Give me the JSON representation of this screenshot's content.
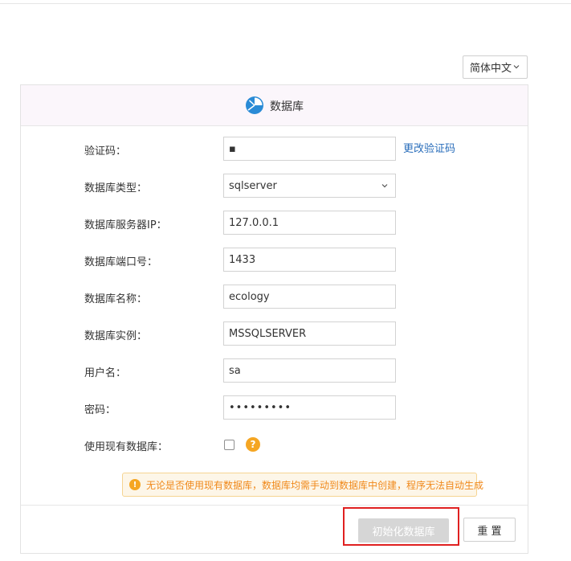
{
  "language": {
    "selected": "简体中文"
  },
  "panel": {
    "title": "数据库",
    "logo_icon": "pie-chart-logo-icon",
    "brand_color": "#2a8bd6"
  },
  "form": {
    "captcha": {
      "label": "验证码：",
      "value": "▪",
      "refresh_link": "更改验证码"
    },
    "db_type": {
      "label": "数据库类型：",
      "value": "sqlserver"
    },
    "server_ip": {
      "label": "数据库服务器IP：",
      "value": "127.0.0.1"
    },
    "port": {
      "label": "数据库端口号：",
      "value": "1433"
    },
    "db_name": {
      "label": "数据库名称：",
      "value": "ecology"
    },
    "instance": {
      "label": "数据库实例：",
      "value": "MSSQLSERVER"
    },
    "username": {
      "label": "用户名：",
      "value": "sa"
    },
    "password": {
      "label": "密码：",
      "value": "•••••••••"
    },
    "use_existing": {
      "label": "使用现有数据库：",
      "checked": false,
      "help_icon": "question-icon",
      "help_symbol": "?"
    }
  },
  "warning": {
    "text": "无论是否使用现有数据库，数据库均需手动到数据库中创建，程序无法自动生成",
    "icon": "exclamation-icon",
    "icon_symbol": "!",
    "color": "#f0891b"
  },
  "actions": {
    "init_label": "初始化数据库",
    "reset_label": "重 置",
    "highlight_color": "#e02020"
  }
}
